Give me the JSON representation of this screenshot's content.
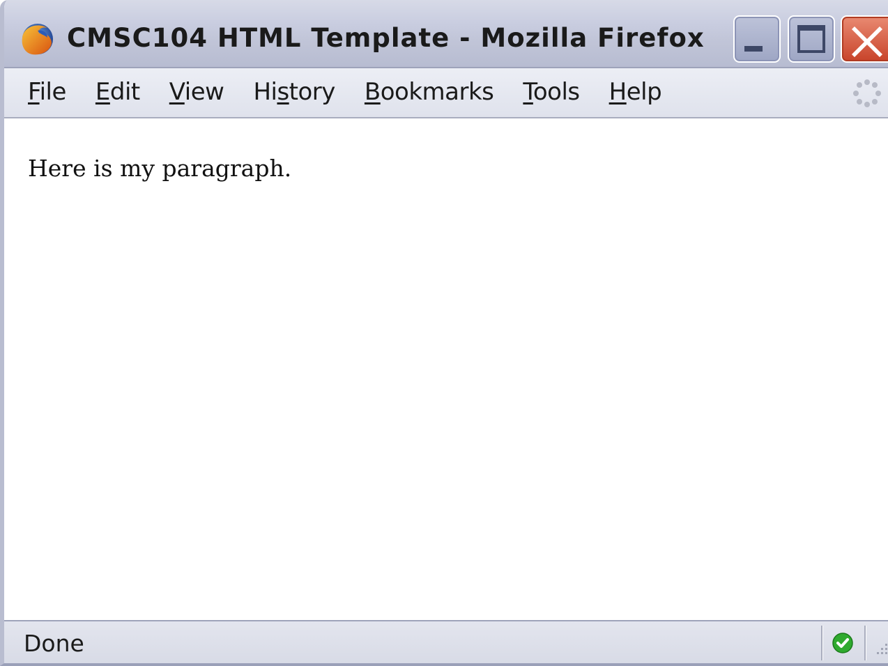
{
  "window": {
    "title": "CMSC104 HTML Template - Mozilla Firefox",
    "app_icon": "firefox-icon",
    "controls": [
      "minimize-icon",
      "maximize-icon",
      "close-icon"
    ]
  },
  "menubar": {
    "items": [
      {
        "label": "File",
        "accel": "F",
        "rest": "ile"
      },
      {
        "label": "Edit",
        "accel": "E",
        "rest": "dit"
      },
      {
        "label": "View",
        "accel": "V",
        "rest": "iew"
      },
      {
        "label": "History",
        "pre": "Hi",
        "accel": "s",
        "rest": "tory"
      },
      {
        "label": "Bookmarks",
        "accel": "B",
        "rest": "ookmarks"
      },
      {
        "label": "Tools",
        "accel": "T",
        "rest": "ools"
      },
      {
        "label": "Help",
        "accel": "H",
        "rest": "elp"
      }
    ],
    "throbber_icon": "loading-throbber-icon"
  },
  "content": {
    "paragraph": "Here is my paragraph."
  },
  "statusbar": {
    "status": "Done",
    "secure_icon": "check-icon"
  },
  "colors": {
    "titlebar": "#c1c5d8",
    "close_button": "#c8432a",
    "status_ok": "#2faa2f"
  }
}
